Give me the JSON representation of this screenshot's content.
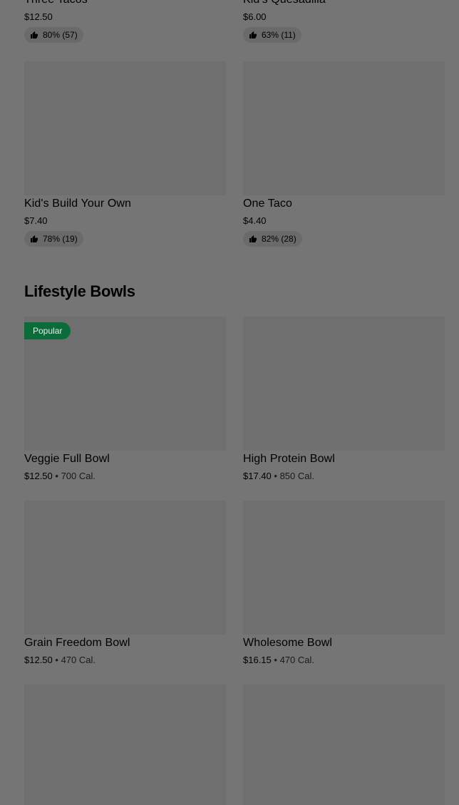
{
  "top_row": [
    {
      "name": "Three Tacos",
      "price": "$12.50",
      "rating": "80% (57)"
    },
    {
      "name": "Kid's Quesadilla",
      "price": "$6.00",
      "rating": "63% (11)"
    }
  ],
  "row2": [
    {
      "name": "Kid's Build Your Own",
      "price": "$7.40",
      "rating": "78% (19)"
    },
    {
      "name": "One Taco",
      "price": "$4.40",
      "rating": "82% (28)"
    }
  ],
  "section": {
    "title": "Lifestyle Bowls"
  },
  "bowls_row1": [
    {
      "badge": "Popular",
      "name": "Veggie Full Bowl",
      "price": "$12.50",
      "calories": "700 Cal."
    },
    {
      "name": "High Protein Bowl",
      "price": "$17.40",
      "calories": "850 Cal."
    }
  ],
  "bowls_row2": [
    {
      "name": "Grain Freedom Bowl",
      "price": "$12.50",
      "calories": "470 Cal."
    },
    {
      "name": "Wholesome Bowl",
      "price": "$16.15",
      "calories": "470 Cal."
    }
  ],
  "separator": "•",
  "colors": {
    "background": "#757575",
    "badge": "#0b6b3a"
  },
  "icons": {
    "rating": "thumbs-up-icon"
  }
}
